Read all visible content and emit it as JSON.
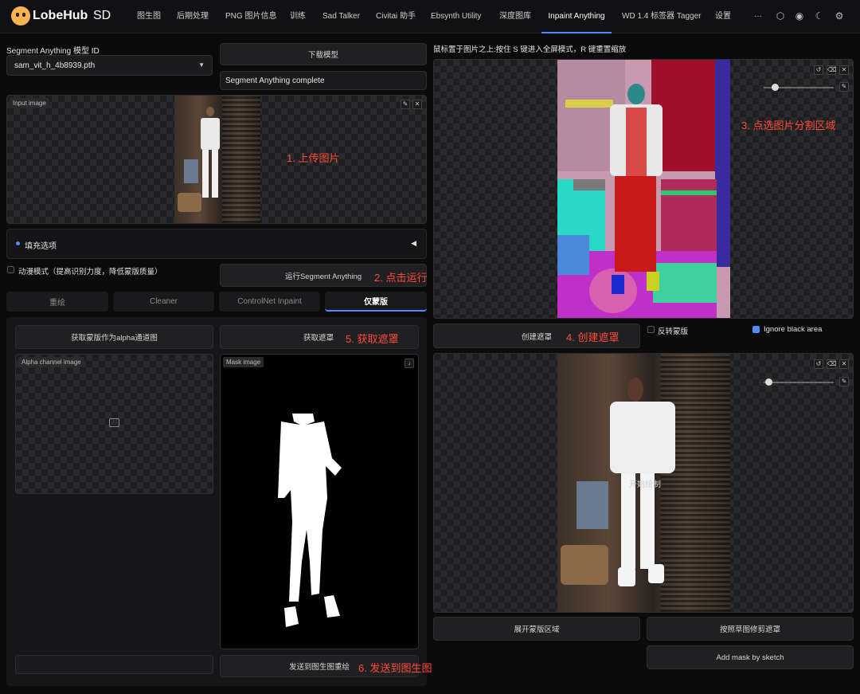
{
  "app": {
    "brand": "LobeHub",
    "suffix": "SD"
  },
  "nav": {
    "tabs": [
      "图生图",
      "后期处理",
      "PNG 图片信息",
      "训练",
      "Sad Talker",
      "Civitai 助手",
      "Ebsynth Utility",
      "深度图库",
      "Inpaint Anything",
      "WD 1.4 标签器 Tagger",
      "设置"
    ],
    "active": "Inpaint Anything",
    "more": "···"
  },
  "icons": {
    "nav_right": [
      "hexagon-icon",
      "github-icon",
      "moon-icon",
      "gear-icon"
    ]
  },
  "left": {
    "model_label": "Segment Anything 模型 ID",
    "model_value": "sam_vit_h_4b8939.pth",
    "download_btn": "下载模型",
    "status": "Segment Anything complete",
    "input_image_tag": "Input image",
    "fill_options": "填充选项",
    "anime_mode": "动漫模式（提高识别力度，降低蒙版质量）",
    "run_btn": "运行Segment Anything",
    "subtabs": [
      "重绘",
      "Cleaner",
      "ControlNet Inpaint",
      "仅蒙版"
    ],
    "get_alpha_btn": "获取蒙版作为alpha通道图",
    "get_mask_btn": "获取遮罩",
    "alpha_tag": "Alpha channel image",
    "mask_tag": "Mask image",
    "send_btn": "发送到图生图重绘"
  },
  "right": {
    "hint": "鼠标置于图片之上:按住 S 键进入全屏模式，R 键重置缩放",
    "create_mask_btn": "创建遮罩",
    "invert_mask": "反转蒙版",
    "ignore_black": "Ignore black area",
    "start_drawing": "开始绘制",
    "expand_btn": "展开蒙版区域",
    "trim_btn": "按照草图修剪遮罩",
    "add_mask_btn": "Add mask by sketch"
  },
  "annotations": {
    "a1": "1. 上传图片",
    "a2": "2. 点击运行",
    "a3": "3. 点选图片分割区域",
    "a4": "4. 创建遮罩",
    "a5": "5. 获取遮罩",
    "a6": "6. 发送到图生图"
  },
  "colors": {
    "accent": "#4c8dff",
    "annotation": "#ff4a3a",
    "background": "#0b0b0c"
  }
}
